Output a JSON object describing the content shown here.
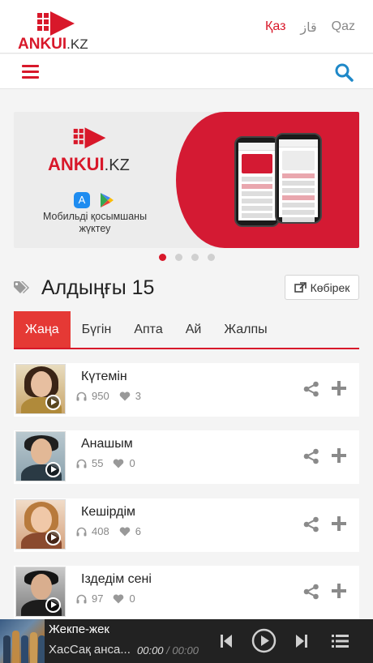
{
  "header": {
    "logo_text": "ANKUI",
    "logo_domain": ".KZ",
    "languages": [
      {
        "label": "Қаз",
        "active": true
      },
      {
        "label": "قاز",
        "active": false
      },
      {
        "label": "Qaz",
        "active": false
      }
    ]
  },
  "navbar": {
    "menu_icon": "hamburger-icon",
    "search_icon": "search-icon"
  },
  "banner": {
    "logo_text": "ANKUI",
    "logo_domain": ".KZ",
    "caption_line1": "Мобильді қосымшаны",
    "caption_line2": "жүктеу",
    "store_icons": [
      "app-store-icon",
      "google-play-icon"
    ],
    "slides_total": 4,
    "active_slide": 1
  },
  "section": {
    "title": "Алдыңғы 15",
    "more_label": "Көбірек",
    "tabs": [
      {
        "label": "Жаңа",
        "active": true
      },
      {
        "label": "Бүгін",
        "active": false
      },
      {
        "label": "Апта",
        "active": false
      },
      {
        "label": "Ай",
        "active": false
      },
      {
        "label": "Жалпы",
        "active": false
      }
    ]
  },
  "tracks": [
    {
      "title": "Күтемін",
      "listens": "950",
      "likes": "3"
    },
    {
      "title": "Анашым",
      "listens": "55",
      "likes": "0"
    },
    {
      "title": "Кешірдім",
      "listens": "408",
      "likes": "6"
    },
    {
      "title": "Іздедім сені",
      "listens": "97",
      "likes": "0"
    }
  ],
  "player": {
    "title": "Жекпе-жек",
    "artist": "ХасСақ анса...",
    "current_time": "00:00",
    "separator": " / ",
    "duration": "00:00"
  },
  "colors": {
    "accent": "#d8182a",
    "tab_active": "#e53935",
    "player_bg": "#222222"
  }
}
